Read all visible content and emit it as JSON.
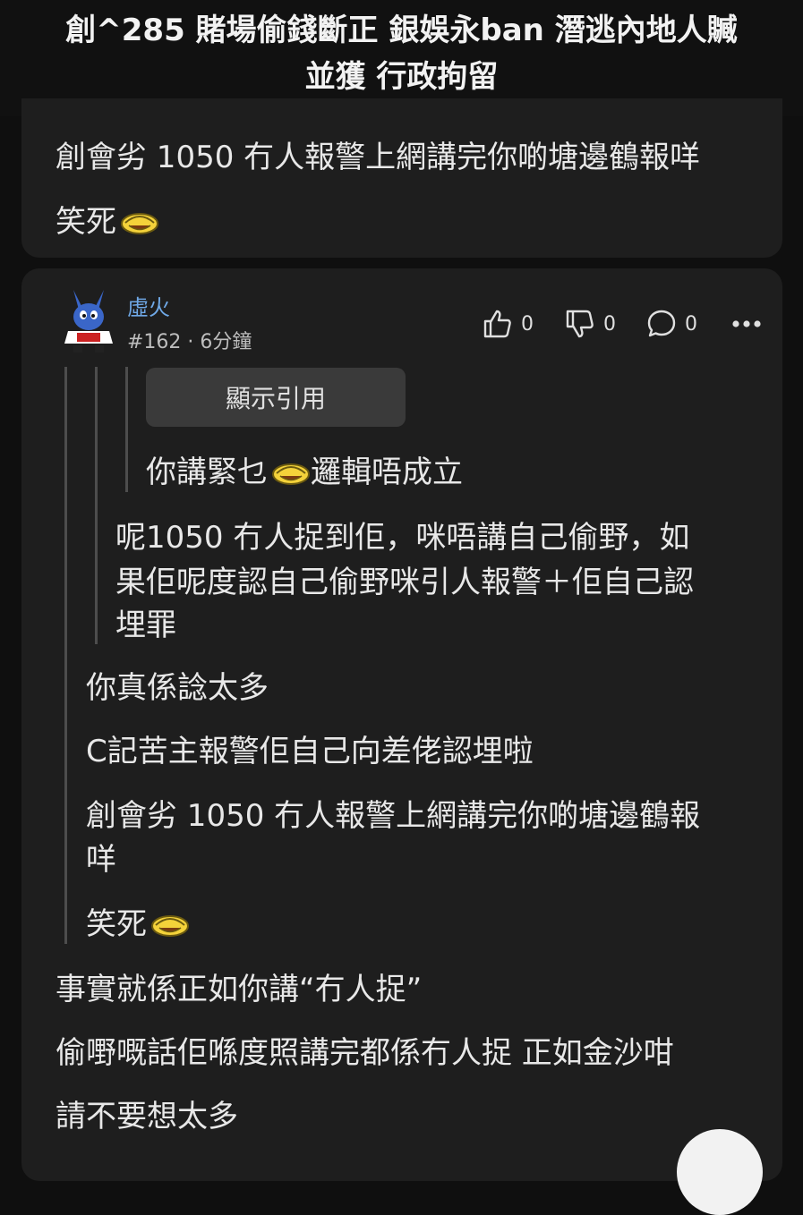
{
  "thread": {
    "title_line1": "創^285 賭場偷錢斷正 銀娛永ban 潛逃內地人贓",
    "title_line2": "並獲 行政拘留"
  },
  "prev_post": {
    "line1": "創會劣 1050 冇人報警上網講完你啲塘邊鶴報咩",
    "line2": "笑死"
  },
  "post": {
    "username": "虛火",
    "meta": "#162 · 6分鐘",
    "likes": "0",
    "dislikes": "0",
    "comments": "0",
    "quote_button": "顯示引用",
    "quote_l3": "你講緊乜",
    "quote_l3_tail": "邏輯唔成立",
    "quote_l2_line1": "呢1050 冇人捉到佢，咪唔講自己偷野，如",
    "quote_l2_line2": "果佢呢度認自己偷野咪引人報警＋佢自己認",
    "quote_l2_line3": "埋罪",
    "quote_l1_line1": "你真係諗太多",
    "quote_l1_line2": "C記苦主報警佢自己向差佬認埋啦",
    "quote_l1_line3": "創會劣 1050 冇人報警上網講完你啲塘邊鶴報",
    "quote_l1_line4": "咩",
    "quote_l1_line5": "笑死",
    "reply_line1": "事實就係正如你講“冇人捉”",
    "reply_line2": "偷嘢嘅話佢喺度照講完都係冇人捉 正如金沙咁",
    "reply_line3": "請不要想太多"
  },
  "icons": {
    "like": "thumbs-up-icon",
    "dislike": "thumbs-down-icon",
    "comment": "comment-bubble-icon",
    "more": "more-dots-icon",
    "emoji": "laughing-face-emoji"
  },
  "colors": {
    "username": "#6fa8e6",
    "card": "#1e1e1e",
    "background": "#0f0f0f"
  }
}
